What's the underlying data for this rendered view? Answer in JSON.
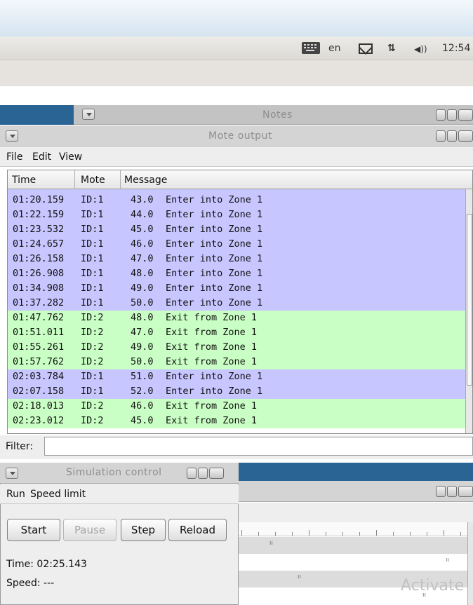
{
  "system_panel": {
    "keyboard_icon": "keyboard-icon",
    "language": "en",
    "mail_icon": "mail-icon",
    "network_icon": "network-icon",
    "network_glyph": "⇅",
    "volume_icon": "volume-icon",
    "volume_glyph": "◀))",
    "clock": "12:54"
  },
  "notes_window": {
    "title": "Notes"
  },
  "mote_output": {
    "title": "Mote output",
    "menu": [
      "File",
      "Edit",
      "View"
    ],
    "columns": [
      "Time",
      "Mote",
      "Message"
    ],
    "rows": [
      {
        "time": "01:20.159",
        "mote": "ID:1",
        "value": "43.0",
        "text": "Enter into Zone 1",
        "zone": "z1"
      },
      {
        "time": "01:22.159",
        "mote": "ID:1",
        "value": "44.0",
        "text": "Enter into Zone 1",
        "zone": "z1"
      },
      {
        "time": "01:23.532",
        "mote": "ID:1",
        "value": "45.0",
        "text": "Enter into Zone 1",
        "zone": "z1"
      },
      {
        "time": "01:24.657",
        "mote": "ID:1",
        "value": "46.0",
        "text": "Enter into Zone 1",
        "zone": "z1"
      },
      {
        "time": "01:26.158",
        "mote": "ID:1",
        "value": "47.0",
        "text": "Enter into Zone 1",
        "zone": "z1"
      },
      {
        "time": "01:26.908",
        "mote": "ID:1",
        "value": "48.0",
        "text": "Enter into Zone 1",
        "zone": "z1"
      },
      {
        "time": "01:34.908",
        "mote": "ID:1",
        "value": "49.0",
        "text": "Enter into Zone 1",
        "zone": "z1"
      },
      {
        "time": "01:37.282",
        "mote": "ID:1",
        "value": "50.0",
        "text": "Enter into Zone 1",
        "zone": "z1"
      },
      {
        "time": "01:47.762",
        "mote": "ID:2",
        "value": "48.0",
        "text": "Exit from Zone 1",
        "zone": "z2"
      },
      {
        "time": "01:51.011",
        "mote": "ID:2",
        "value": "47.0",
        "text": "Exit from Zone 1",
        "zone": "z2"
      },
      {
        "time": "01:55.261",
        "mote": "ID:2",
        "value": "49.0",
        "text": "Exit from Zone 1",
        "zone": "z2"
      },
      {
        "time": "01:57.762",
        "mote": "ID:2",
        "value": "50.0",
        "text": "Exit from Zone 1",
        "zone": "z2"
      },
      {
        "time": "02:03.784",
        "mote": "ID:1",
        "value": "51.0",
        "text": "Enter into Zone 1",
        "zone": "z1"
      },
      {
        "time": "02:07.158",
        "mote": "ID:1",
        "value": "52.0",
        "text": "Enter into Zone 1",
        "zone": "z1"
      },
      {
        "time": "02:18.013",
        "mote": "ID:2",
        "value": "46.0",
        "text": "Exit from Zone 1",
        "zone": "z2"
      },
      {
        "time": "02:23.012",
        "mote": "ID:2",
        "value": "45.0",
        "text": "Exit from Zone 1",
        "zone": "z2"
      }
    ],
    "row_colors": {
      "z1": "#c8c6ff",
      "z2": "#c9ffc4"
    },
    "filter_label": "Filter:",
    "filter_value": ""
  },
  "simulation_control": {
    "title": "Simulation control",
    "menu": [
      "Run",
      "Speed limit"
    ],
    "buttons": {
      "start": "Start",
      "pause": "Pause",
      "step": "Step",
      "reload": "Reload"
    },
    "time_label": "Time: 02:25.143",
    "speed_label": "Speed: ---"
  },
  "watermark": "Activate",
  "accent": "#2a6495"
}
